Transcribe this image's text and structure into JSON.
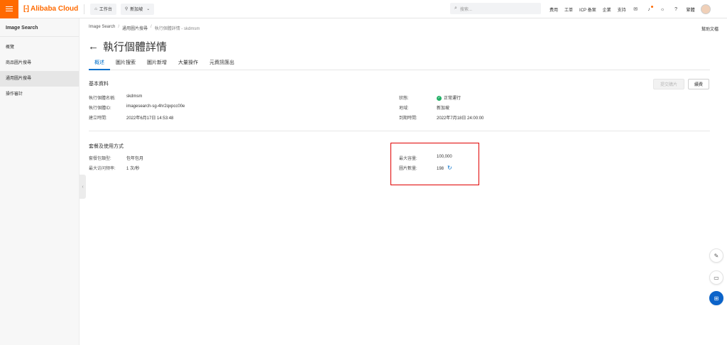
{
  "topbar": {
    "logo_text": "Alibaba Cloud",
    "workbench_label": "工作台",
    "region_label": "新加坡",
    "search_placeholder": "搜索...",
    "links": [
      "费用",
      "工单",
      "ICP 备案",
      "企業",
      "支持"
    ],
    "user_label": "繁體",
    "accent_color": "#ff6a00"
  },
  "sidebar": {
    "title": "Image Search",
    "items": [
      {
        "label": "概覽"
      },
      {
        "label": "商品圖片搜尋"
      },
      {
        "label": "通用圖片搜尋"
      },
      {
        "label": "操作審計"
      }
    ]
  },
  "breadcrumb": [
    "Image Search",
    "通用圖片搜尋",
    "執行個體詳情 - skdmsm"
  ],
  "help_doc_label": "幫助文檔",
  "page_title": "執行個體詳情",
  "tabs": [
    "概述",
    "圖片搜索",
    "圖片新增",
    "大量操作",
    "元資訊匯出"
  ],
  "basic_info": {
    "title": "基本資料",
    "sync_button": "提交購片",
    "renew_button": "續費",
    "fields_left": [
      {
        "key": "執行個體名稱:",
        "value": "skdmsm"
      },
      {
        "key": "執行個體ID:",
        "value": "imagesearch-sg-4hr2qxpcc00e"
      },
      {
        "key": "建立時間:",
        "value": "2022年6月17日 14:53:48"
      }
    ],
    "fields_right": [
      {
        "key": "狀態:",
        "value": "正常運行"
      },
      {
        "key": "地域:",
        "value": "新加坡"
      },
      {
        "key": "到期時間:",
        "value": "2022年7月18日 24:00:00"
      }
    ],
    "status_color": "#23b066"
  },
  "plan_info": {
    "title": "套餐及使用方式",
    "fields_left": [
      {
        "key": "套餐包類型:",
        "value": "包年包月"
      },
      {
        "key": "最大访问频率:",
        "value": "1 次/秒"
      }
    ],
    "fields_right": [
      {
        "key": "最大容量:",
        "value": "100,000"
      },
      {
        "key": "圖片數量:",
        "value": "198"
      }
    ]
  },
  "highlight_color": "#e00000"
}
